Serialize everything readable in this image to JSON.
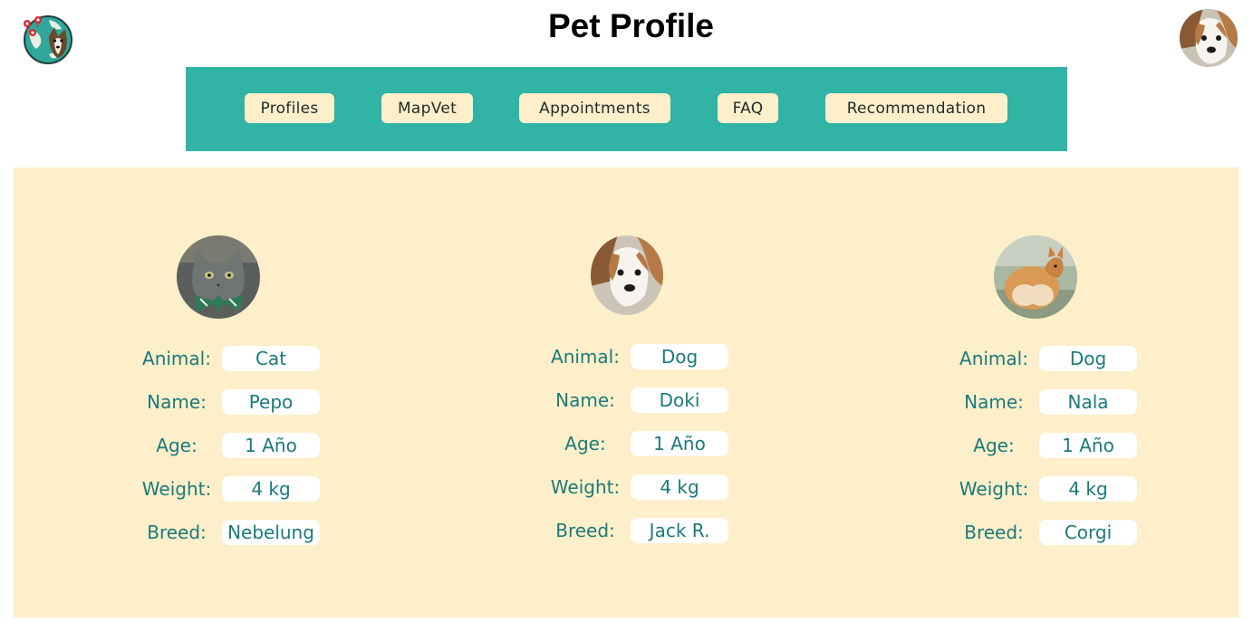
{
  "header": {
    "title": "Pet Profile",
    "logo_icon": "globe-dog-logo",
    "avatar_icon": "dog-avatar"
  },
  "nav": {
    "items": [
      {
        "label": "Profiles"
      },
      {
        "label": "MapVet"
      },
      {
        "label": "Appointments"
      },
      {
        "label": "FAQ"
      },
      {
        "label": "Recommendation"
      }
    ]
  },
  "field_labels": {
    "animal": "Animal:",
    "name": "Name:",
    "age": "Age:",
    "weight": "Weight:",
    "breed": "Breed:"
  },
  "pets": [
    {
      "animal": "Cat",
      "name": "Pepo",
      "age": "1 Año",
      "weight": "4 kg",
      "breed": "Nebelung",
      "photo_icon": "grey-cat-photo"
    },
    {
      "animal": "Dog",
      "name": "Doki",
      "age": "1 Año",
      "weight": "4 kg",
      "breed": "Jack R.",
      "photo_icon": "jack-russell-photo"
    },
    {
      "animal": "Dog",
      "name": "Nala",
      "age": "1 Año",
      "weight": "4 kg",
      "breed": "Corgi",
      "photo_icon": "corgi-photo"
    }
  ],
  "colors": {
    "nav_bg": "#31b3a6",
    "cream": "#fdefc9",
    "label_text": "#1b7a7c"
  }
}
